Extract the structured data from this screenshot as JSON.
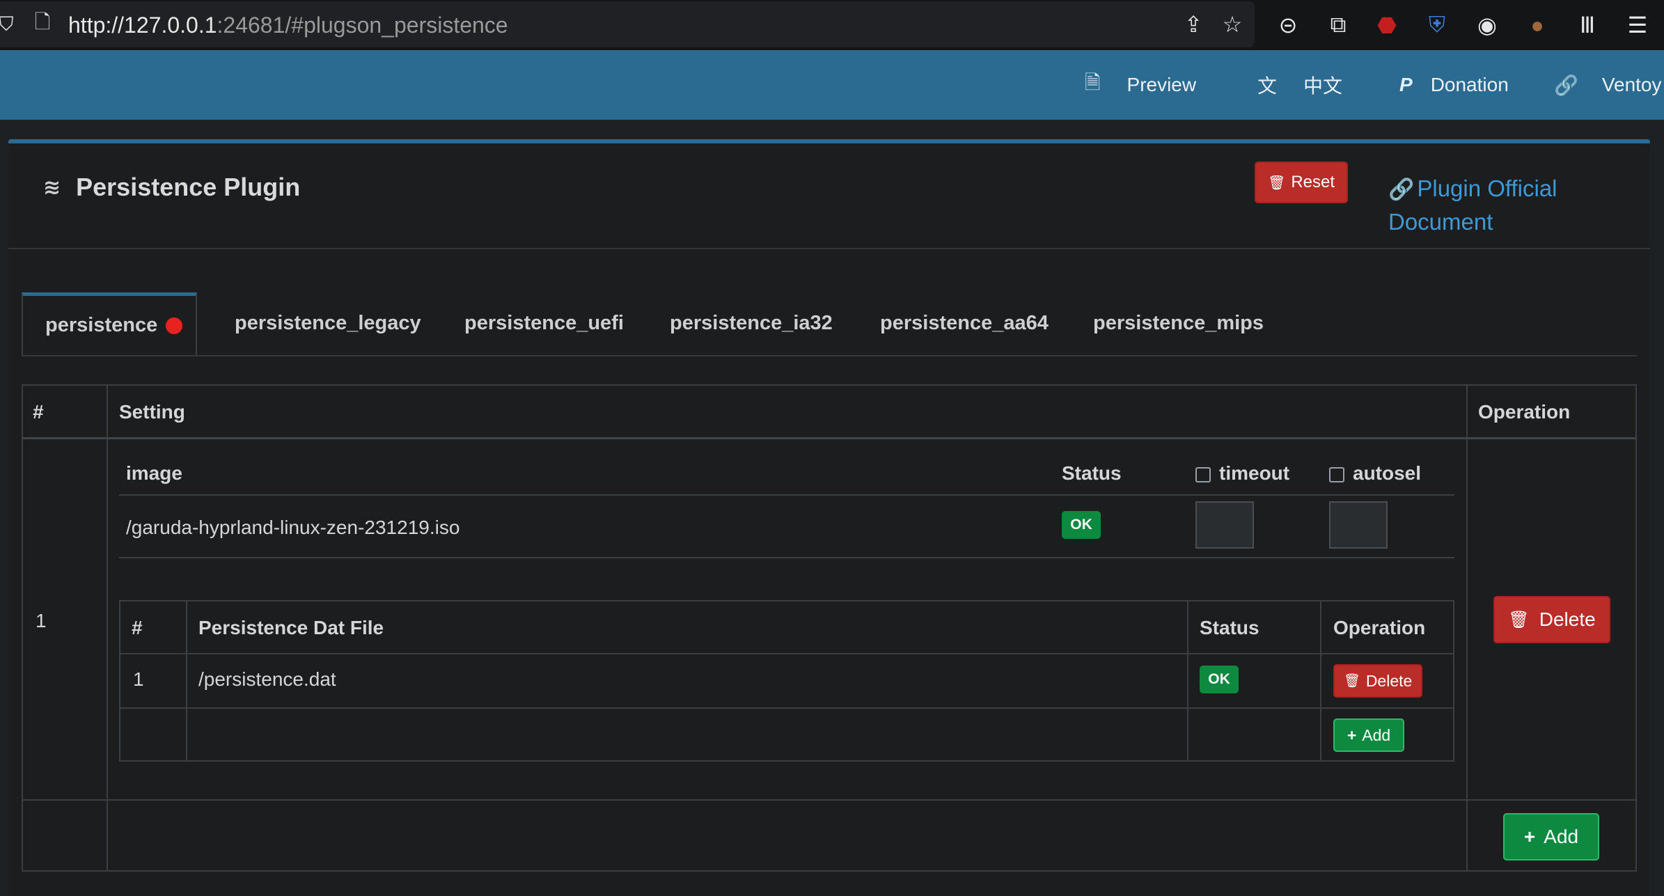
{
  "browser": {
    "url_host": "http://127.0.0.1",
    "url_rest": ":24681/#plugson_persistence"
  },
  "navbar": {
    "preview": "Preview",
    "language": "中文",
    "donation": "Donation",
    "ventoy": "Ventoy"
  },
  "header": {
    "title": "Persistence Plugin",
    "reset_label": "Reset",
    "doc_link": "Plugin Official Document"
  },
  "tabs": [
    {
      "label": "persistence",
      "active": true,
      "marked": true
    },
    {
      "label": "persistence_legacy"
    },
    {
      "label": "persistence_uefi"
    },
    {
      "label": "persistence_ia32"
    },
    {
      "label": "persistence_aa64"
    },
    {
      "label": "persistence_mips"
    }
  ],
  "main_table": {
    "headers": {
      "num": "#",
      "setting": "Setting",
      "operation": "Operation"
    },
    "rows": [
      {
        "num": "1",
        "image_table": {
          "headers": {
            "image": "image",
            "status": "Status",
            "timeout": "timeout",
            "autosel": "autosel"
          },
          "image": "/garuda-hyprland-linux-zen-231219.iso",
          "status": "OK"
        },
        "dat_table": {
          "headers": {
            "num": "#",
            "file": "Persistence Dat File",
            "status": "Status",
            "operation": "Operation"
          },
          "rows": [
            {
              "num": "1",
              "file": "/persistence.dat",
              "status": "OK",
              "delete_label": "Delete"
            }
          ],
          "add_label": "Add"
        },
        "delete_label": "Delete"
      }
    ],
    "add_label": "Add"
  }
}
